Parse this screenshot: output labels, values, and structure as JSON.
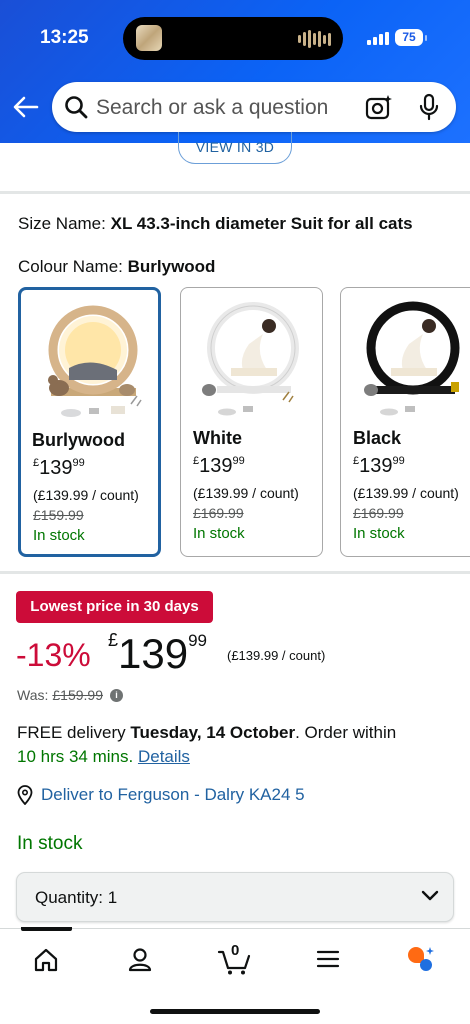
{
  "status_bar": {
    "time": "13:25",
    "battery": "75"
  },
  "search": {
    "placeholder": "Search or ask a question"
  },
  "view_3d_label": "VIEW IN 3D",
  "size": {
    "label": "Size Name:",
    "value": "XL 43.3-inch diameter Suit for all cats"
  },
  "colour": {
    "label": "Colour Name:",
    "value": "Burlywood"
  },
  "swatches": [
    {
      "name": "Burlywood",
      "currency": "£",
      "whole": "139",
      "fraction": "99",
      "unit_price": "(£139.99 / count)",
      "was_price": "£159.99",
      "stock": "In stock",
      "selected": true
    },
    {
      "name": "White",
      "currency": "£",
      "whole": "139",
      "fraction": "99",
      "unit_price": "(£139.99 / count)",
      "was_price": "£169.99",
      "stock": "In stock",
      "selected": false
    },
    {
      "name": "Black",
      "currency": "£",
      "whole": "139",
      "fraction": "99",
      "unit_price": "(£139.99 / count)",
      "was_price": "£169.99",
      "stock": "In stock",
      "selected": false
    }
  ],
  "deal_badge": "Lowest price in 30 days",
  "price": {
    "discount": "-13%",
    "currency": "£",
    "whole": "139",
    "fraction": "99",
    "unit_price": "(£139.99 / count)"
  },
  "was": {
    "label": "Was:",
    "value": "£159.99"
  },
  "delivery": {
    "prefix": "FREE delivery ",
    "date": "Tuesday, 14 October",
    "suffix": ". Order within",
    "countdown": "10 hrs 34 mins",
    "dot": ".",
    "details_link": "Details"
  },
  "deliver_to": "Deliver to Ferguson - Dalry KA24 5",
  "stock_status": "In stock",
  "quantity": {
    "label": "Quantity:",
    "value": "1"
  },
  "nav": {
    "cart_count": "0"
  },
  "colors": {
    "accent": "#2162a1",
    "deal": "#cc0c39",
    "stock": "#007600",
    "header": "#0b63f6"
  }
}
